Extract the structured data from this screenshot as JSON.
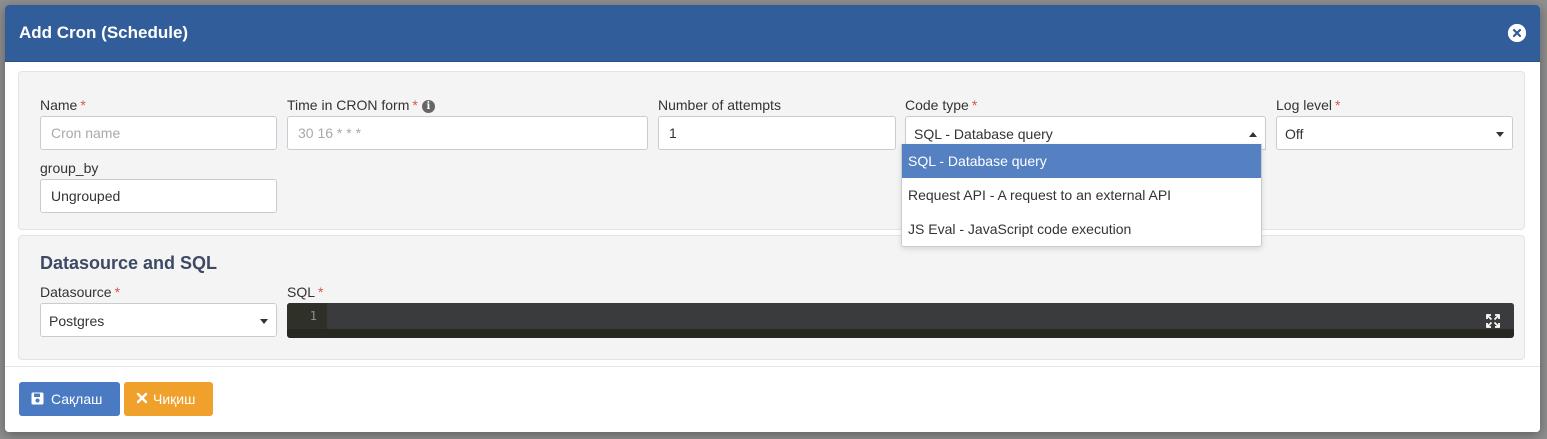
{
  "modal": {
    "title": "Add Cron (Schedule)"
  },
  "fields": {
    "name": {
      "label": "Name",
      "required": "*",
      "placeholder": "Cron name"
    },
    "cron_time": {
      "label": "Time in CRON form",
      "required": "*",
      "info": "i",
      "placeholder": "30 16 * * *"
    },
    "attempts": {
      "label": "Number of attempts",
      "value": "1"
    },
    "code_type": {
      "label": "Code type",
      "required": "*",
      "value": "SQL - Database query"
    },
    "log_level": {
      "label": "Log level",
      "required": "*",
      "value": "Off"
    },
    "group_by": {
      "label": "group_by",
      "value": "Ungrouped"
    }
  },
  "code_type_options": [
    "SQL - Database query",
    "Request API - A request to an external API",
    "JS Eval - JavaScript code execution"
  ],
  "datasource_section": {
    "title": "Datasource and SQL",
    "datasource": {
      "label": "Datasource",
      "required": "*",
      "value": "Postgres"
    },
    "sql": {
      "label": "SQL",
      "required": "*",
      "line_number": "1"
    }
  },
  "footer": {
    "save_label": "Сақлаш",
    "exit_label": "Чиқиш"
  },
  "colors": {
    "header": "#325d9b",
    "save_button": "#4a7bc2",
    "exit_button": "#f0a12c",
    "required": "#d9534f",
    "selected_option": "#5581c3"
  },
  "icons": {
    "close": "close-icon",
    "info": "info-icon",
    "save": "save-icon",
    "exit": "times-icon",
    "expand": "expand-icon"
  }
}
